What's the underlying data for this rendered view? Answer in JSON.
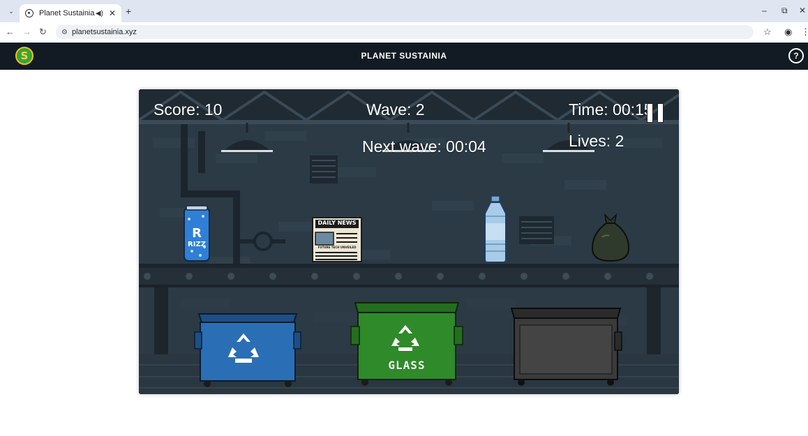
{
  "browser": {
    "tab_title": "Planet Sustainia",
    "tab_menu_icon": "chevron-down-icon",
    "url": "planetsustainia.xyz"
  },
  "app": {
    "title": "PLANET SUSTAINIA",
    "logo_letter": "S",
    "help_label": "?"
  },
  "game": {
    "score": "Score: 10",
    "wave": "Wave: 2",
    "time": "Time: 00:15",
    "next_wave": "Next wave: 00:04",
    "lives": "Lives: 2",
    "items": [
      {
        "name": "soda-can",
        "label_big": "R",
        "label_small": "RIZZ"
      },
      {
        "name": "newspaper",
        "headline": "DAILY NEWS",
        "caption": "FUTURE TECH UNVEILED"
      },
      {
        "name": "plastic-bottle"
      },
      {
        "name": "trash-bag"
      }
    ],
    "bins": [
      {
        "name": "recycling-bin",
        "color": "#2a6fb5",
        "label": ""
      },
      {
        "name": "glass-bin",
        "color": "#2f8a2a",
        "label": "GLASS"
      },
      {
        "name": "general-waste-bin",
        "color": "#3b3b3b",
        "label": ""
      }
    ]
  }
}
